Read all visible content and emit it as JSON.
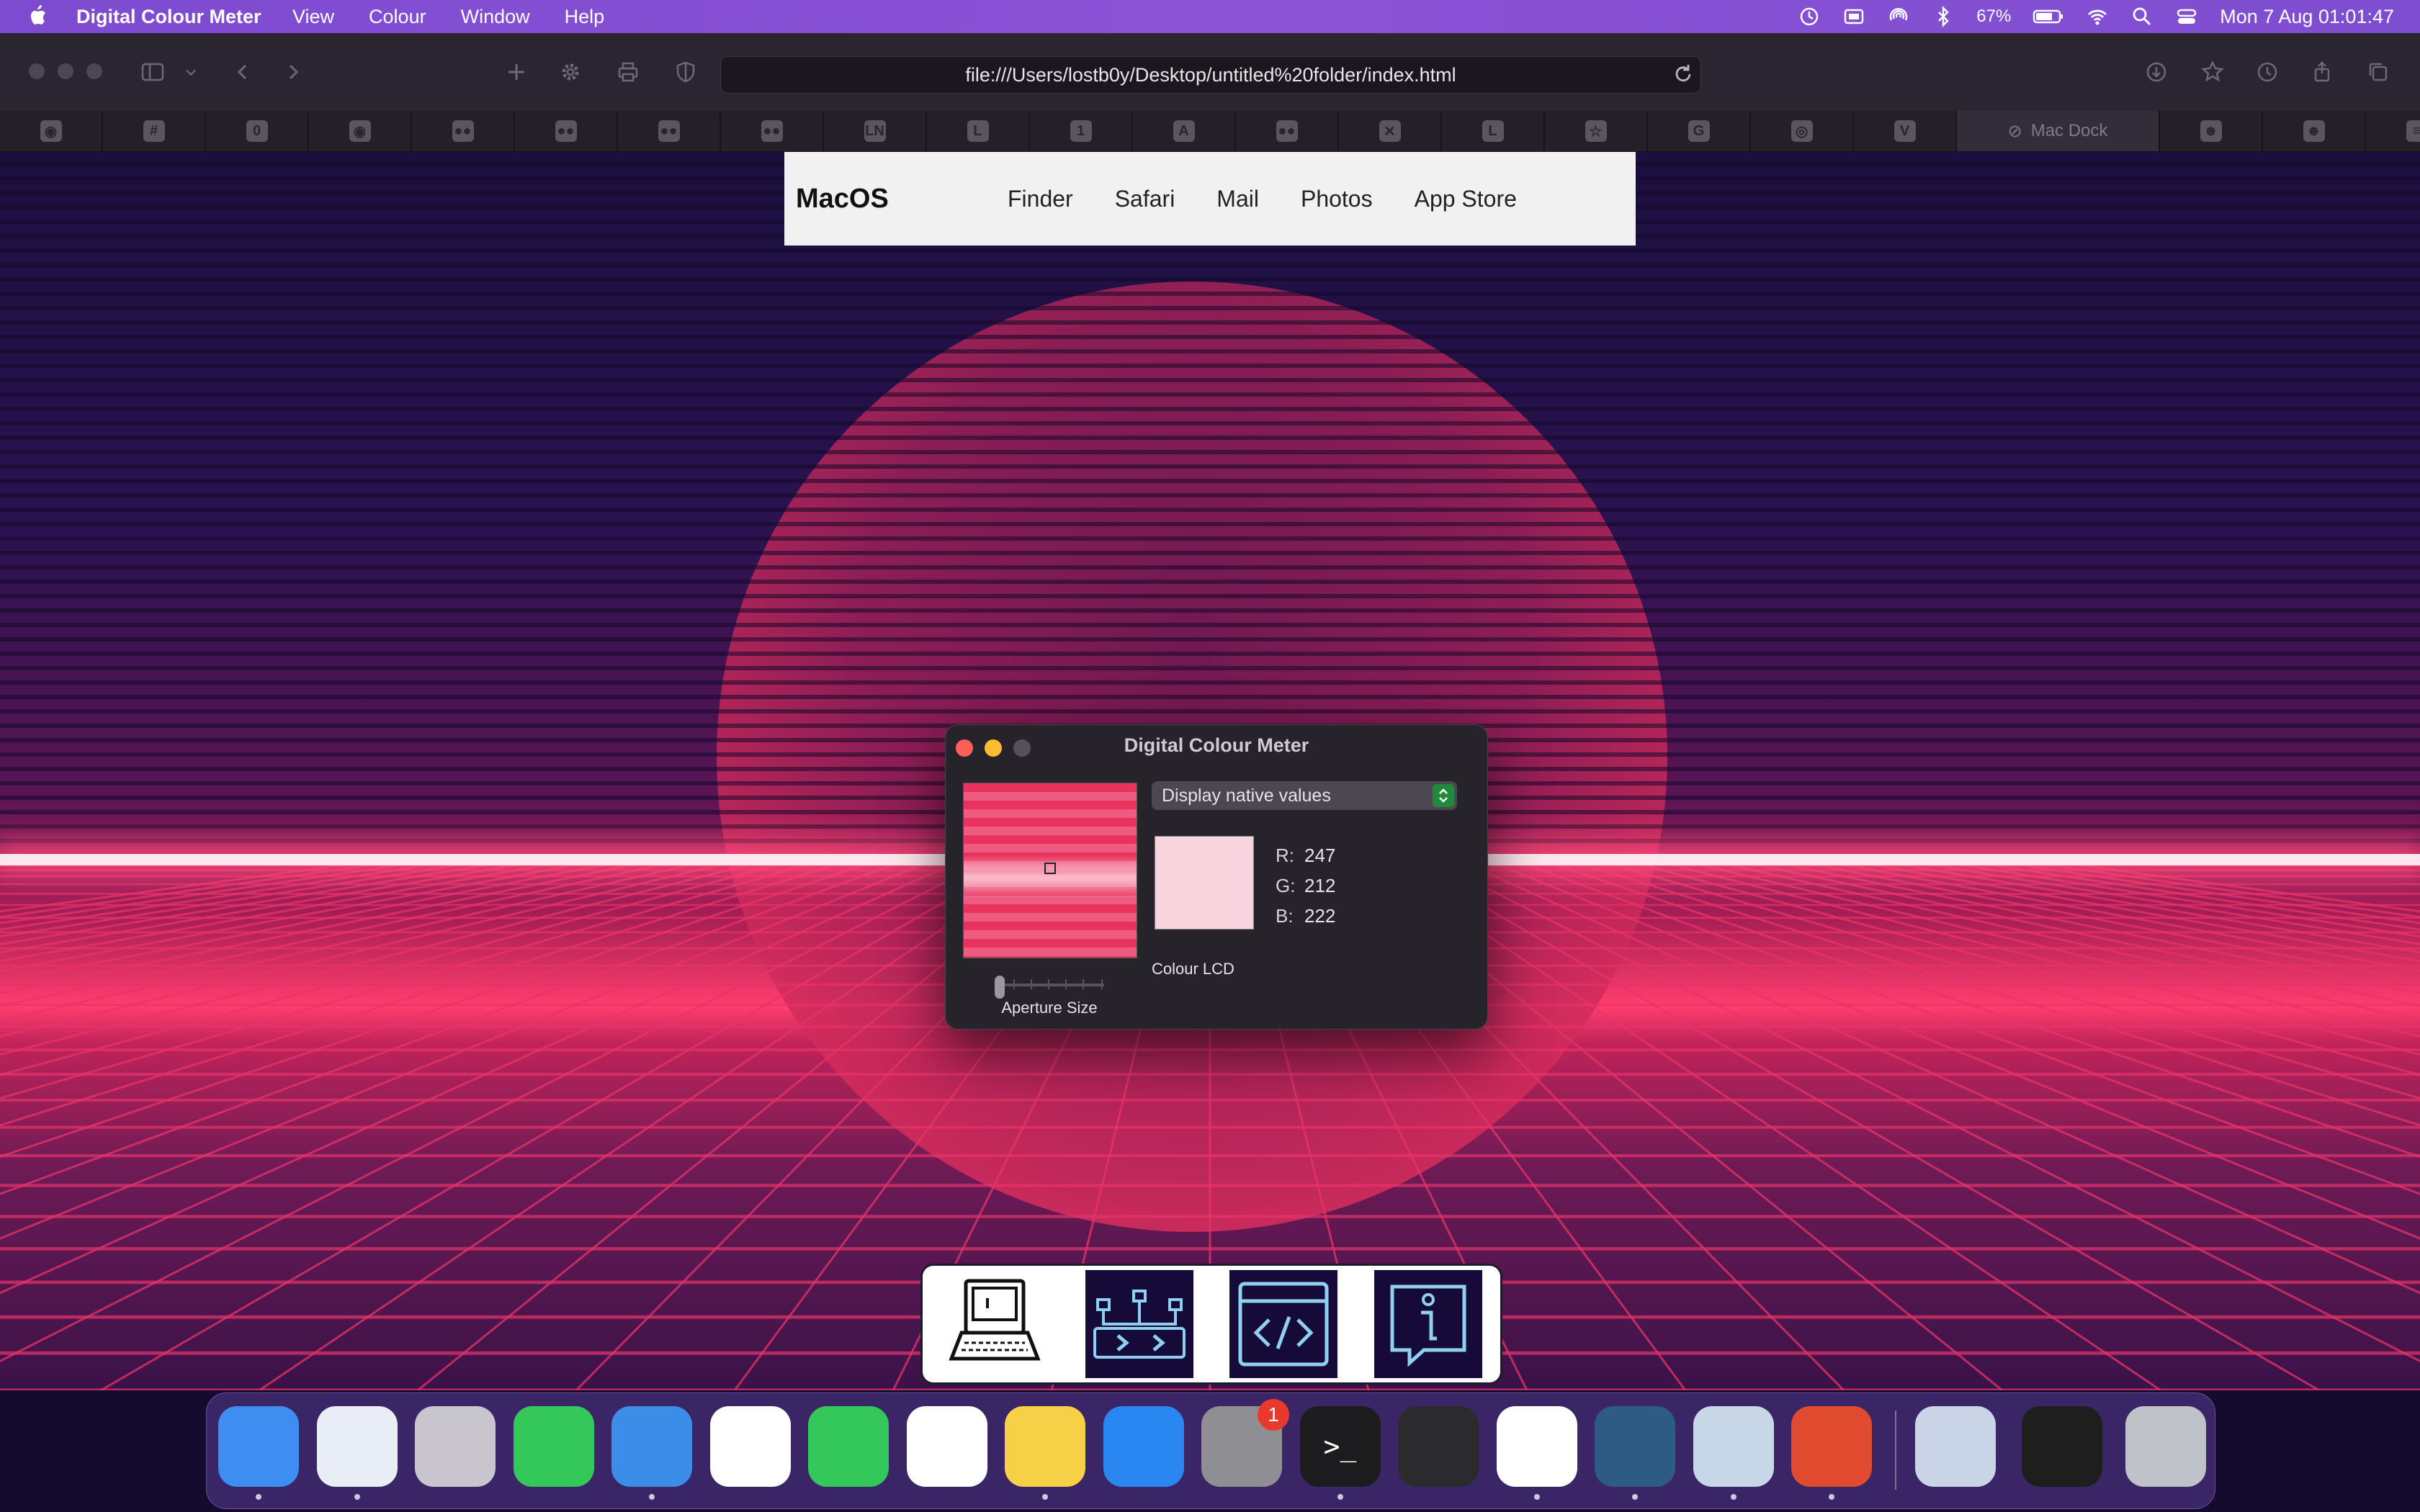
{
  "menubar": {
    "app_name": "Digital Colour Meter",
    "menus": [
      "View",
      "Colour",
      "Window",
      "Help"
    ],
    "battery": "67%",
    "datetime": "Mon 7 Aug  01:01:47",
    "status_icons": [
      "time-machine-icon",
      "screen-icon",
      "airdrop-icon",
      "bluetooth-icon",
      "battery-icon",
      "wifi-icon",
      "spotlight-icon",
      "control-center-icon"
    ]
  },
  "browser": {
    "url": "file:///Users/lostb0y/Desktop/untitled%20folder/index.html",
    "favorites": [
      {
        "icon": "github-icon",
        "glyph": "◉"
      },
      {
        "icon": "slack-icon",
        "glyph": "#"
      },
      {
        "icon": "o-icon",
        "glyph": "0"
      },
      {
        "icon": "github-icon",
        "glyph": "◉"
      },
      {
        "icon": "medium-icon",
        "glyph": "●●"
      },
      {
        "icon": "medium-icon",
        "glyph": "●●"
      },
      {
        "icon": "medium-icon",
        "glyph": "●●"
      },
      {
        "icon": "medium-icon",
        "glyph": "●●"
      },
      {
        "icon": "ln-icon",
        "glyph": "LN"
      },
      {
        "icon": "l-icon",
        "glyph": "L"
      },
      {
        "icon": "one-icon",
        "glyph": "1"
      },
      {
        "icon": "a-icon",
        "glyph": "A"
      },
      {
        "icon": "medium-icon",
        "glyph": "●●"
      },
      {
        "icon": "x-icon",
        "glyph": "✕"
      },
      {
        "icon": "l-icon",
        "glyph": "L"
      },
      {
        "icon": "star-icon",
        "glyph": "☆"
      },
      {
        "icon": "g-icon",
        "glyph": "G"
      },
      {
        "icon": "globe-icon",
        "glyph": "◎"
      },
      {
        "icon": "vue-icon",
        "glyph": "V"
      }
    ],
    "active_tab": "Mac Dock",
    "trailing_favorites": [
      {
        "icon": "reddit-icon",
        "glyph": "☻"
      },
      {
        "icon": "reddit-icon",
        "glyph": "☻"
      },
      {
        "icon": "stack-icon",
        "glyph": "≡"
      }
    ]
  },
  "site": {
    "brand": "MacOS",
    "nav": [
      "Finder",
      "Safari",
      "Mail",
      "Photos",
      "App Store"
    ]
  },
  "colour_meter": {
    "title": "Digital Colour Meter",
    "mode": "Display native values",
    "values": {
      "r": "247",
      "g": "212",
      "b": "222"
    },
    "labels": {
      "r": "R:",
      "g": "G:",
      "b": "B:"
    },
    "swatch_color": "#f7d4de",
    "aperture_label": "Aperture Size",
    "display": "Colour LCD",
    "aperture_level": 0.0
  },
  "dock": {
    "apps": [
      {
        "name": "finder",
        "color": "#3d8ef0",
        "running": true
      },
      {
        "name": "safari",
        "color": "#e9eef6",
        "running": true
      },
      {
        "name": "launchpad",
        "color": "#c9c5cf",
        "running": false
      },
      {
        "name": "messages",
        "color": "#34c759",
        "running": false
      },
      {
        "name": "mail",
        "color": "#3b8de8",
        "running": true
      },
      {
        "name": "photos",
        "color": "#ffffff",
        "running": false
      },
      {
        "name": "facetime",
        "color": "#34c759",
        "running": false
      },
      {
        "name": "reminders",
        "color": "#ffffff",
        "running": false
      },
      {
        "name": "notes",
        "color": "#f6d047",
        "running": true
      },
      {
        "name": "app-store",
        "color": "#2a86f0",
        "running": false
      },
      {
        "name": "system-settings",
        "color": "#8e8e93",
        "running": false
      },
      {
        "name": "terminal",
        "color": "#1c1c1e",
        "running": true
      },
      {
        "name": "quicktime",
        "color": "#2b2b2d",
        "running": false
      },
      {
        "name": "vscode",
        "color": "#ffffff",
        "running": true
      },
      {
        "name": "mysql-workbench",
        "color": "#2d5b83",
        "running": true
      },
      {
        "name": "preview",
        "color": "#c7d7e8",
        "running": true
      },
      {
        "name": "digital-colour-meter",
        "color": "#e04a2e",
        "running": true
      }
    ],
    "settings_badge": "1"
  }
}
